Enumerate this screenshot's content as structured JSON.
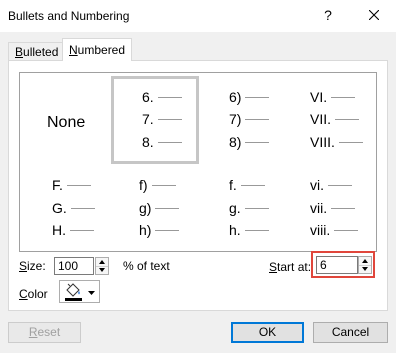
{
  "window": {
    "title": "Bullets and Numbering",
    "help_glyph": "?",
    "close_glyph": "×"
  },
  "tabs": [
    {
      "label_key": "B",
      "label_rest": "ulleted",
      "selected": false
    },
    {
      "label_key": "N",
      "label_rest": "umbered",
      "selected": true
    }
  ],
  "gallery": {
    "none_label": "None",
    "row1": [
      {
        "items": [
          "6.",
          "7.",
          "8."
        ],
        "selected": true
      },
      {
        "items": [
          "6)",
          "7)",
          "8)"
        ]
      },
      {
        "items": [
          "VI.",
          "VII.",
          "VIII."
        ]
      }
    ],
    "row2": [
      {
        "items": [
          "F.",
          "G.",
          "H."
        ]
      },
      {
        "items": [
          "f)",
          "g)",
          "h)"
        ]
      },
      {
        "items": [
          "f.",
          "g.",
          "h."
        ]
      },
      {
        "items": [
          "vi.",
          "vii.",
          "viii."
        ]
      }
    ]
  },
  "size": {
    "label_key": "S",
    "label_rest": "ize:",
    "value": "100",
    "unit": "% of text"
  },
  "start_at": {
    "label_key": "S",
    "label_rest": "tart at:",
    "value": "6",
    "highlight_color": "#e0463b"
  },
  "color": {
    "label_pre": "",
    "label_key": "C",
    "label_rest": "olor",
    "icon": "paint-bucket-icon"
  },
  "buttons": {
    "reset_key": "R",
    "reset_rest": "eset",
    "ok": "OK",
    "cancel": "Cancel"
  },
  "colors": {
    "accent": "#0078d7",
    "highlight": "#e0463b",
    "selection_border": "#c6c6c6"
  }
}
